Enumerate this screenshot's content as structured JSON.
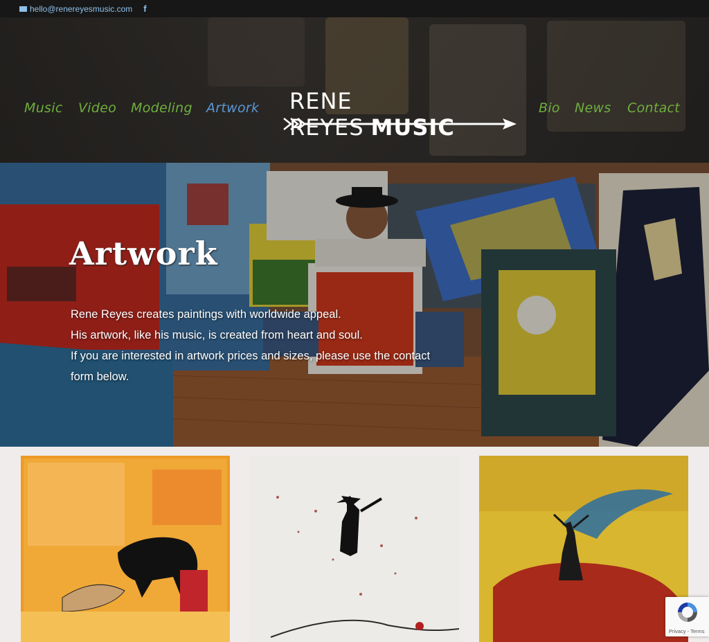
{
  "topbar": {
    "email": "hello@renereyesmusic.com",
    "facebook_glyph": "f",
    "icons": [
      "envelope-icon",
      "facebook-icon"
    ]
  },
  "nav": {
    "left": [
      "Music",
      "Video",
      "Modeling",
      "Artwork"
    ],
    "right": [
      "Bio",
      "News",
      "Contact"
    ],
    "active": "Artwork",
    "colors": {
      "link": "#6fae3e",
      "active": "#5b98d6"
    }
  },
  "logo": {
    "text_light": "RENE REYES",
    "text_bold": "MUSIC"
  },
  "hero": {
    "title": "Artwork",
    "lines": [
      "Rene Reyes creates paintings with worldwide appeal.",
      "His artwork, like his music, is created from heart and soul.",
      "If you are interested in artwork prices and sizes, please use the contact form below."
    ]
  },
  "recaptcha": {
    "links": "Privacy - Terms"
  }
}
